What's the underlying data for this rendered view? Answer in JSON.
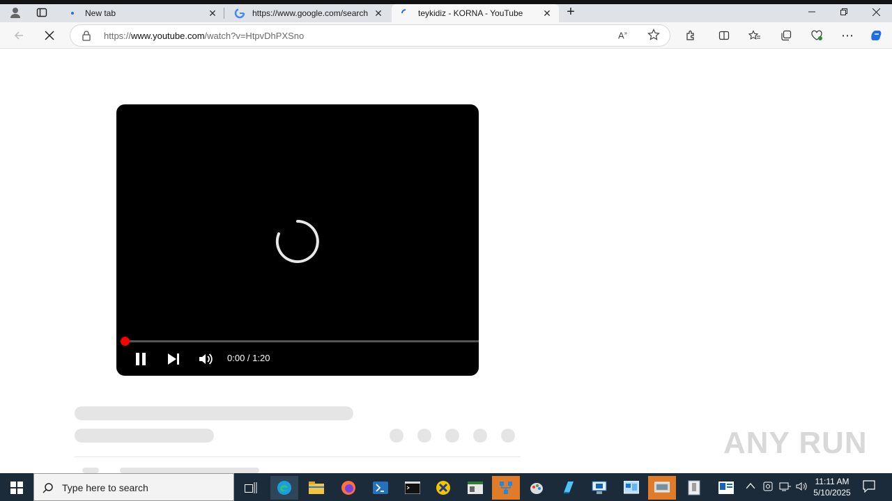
{
  "browser": {
    "tabs": [
      {
        "title": "New tab",
        "active": false
      },
      {
        "title": "https://www.google.com/search",
        "active": false
      },
      {
        "title": "teykidiz - KORNA - YouTube",
        "active": true
      }
    ],
    "url_prefix": "https://",
    "url_host": "www.youtube.com",
    "url_path": "/watch?v=HtpvDhPXSno"
  },
  "player": {
    "time_display": "0:00 / 1:20",
    "progress_fraction": 0.0,
    "state": "loading"
  },
  "taskbar": {
    "search_placeholder": "Type here to search",
    "time": "11:11 AM",
    "date": "5/10/2025"
  },
  "watermark": "ANY RUN",
  "colors": {
    "progress": "#ff0000",
    "taskbar": "#1c2b3a",
    "accent_app": "#e07b2a"
  }
}
